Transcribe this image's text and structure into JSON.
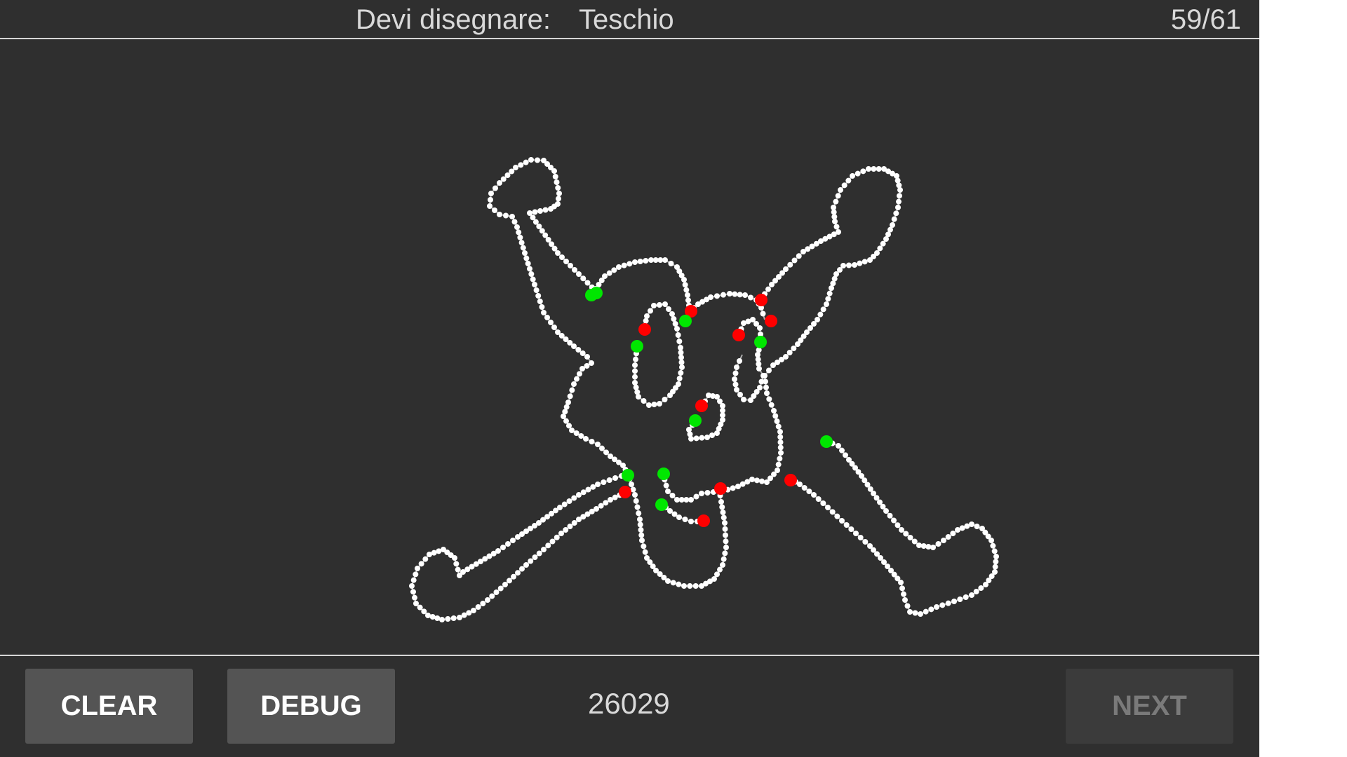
{
  "header": {
    "prompt_label": "Devi disegnare:",
    "prompt_word": "Teschio",
    "progress": "59/61"
  },
  "toolbar": {
    "clear_label": "CLEAR",
    "debug_label": "DEBUG",
    "score": "26029",
    "next_label": "NEXT",
    "next_enabled": false
  },
  "drawing": {
    "stroke_color": "#ffffff",
    "start_marker_color": "#00e600",
    "end_marker_color": "#ff0000",
    "stroke_count": 11
  },
  "colors": {
    "background": "#2f2f2f",
    "divider": "#d6d6d6",
    "button": "#545454",
    "button_disabled": "#3b3b3b"
  }
}
